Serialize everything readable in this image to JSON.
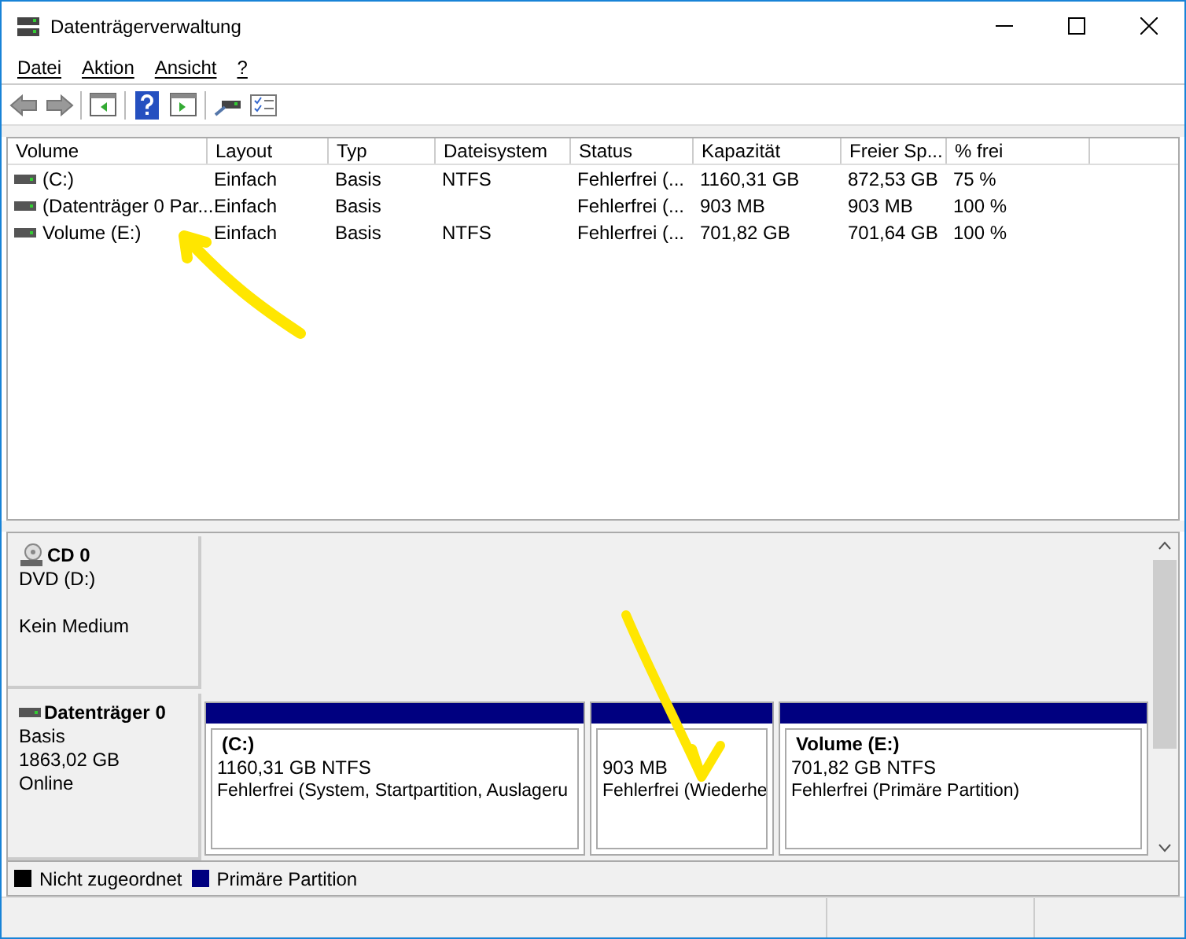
{
  "window": {
    "title": "Datenträgerverwaltung"
  },
  "menu": [
    "Datei",
    "Aktion",
    "Ansicht",
    "?"
  ],
  "table": {
    "columns": [
      "Volume",
      "Layout",
      "Typ",
      "Dateisystem",
      "Status",
      "Kapazität",
      "Freier Sp...",
      "% frei"
    ],
    "rows": [
      [
        "(C:)",
        "Einfach",
        "Basis",
        "NTFS",
        "Fehlerfrei (...",
        "1160,31 GB",
        "872,53 GB",
        "75 %"
      ],
      [
        "(Datenträger 0 Par...",
        "Einfach",
        "Basis",
        "",
        "Fehlerfrei (...",
        "903 MB",
        "903 MB",
        "100 %"
      ],
      [
        "Volume (E:)",
        "Einfach",
        "Basis",
        "NTFS",
        "Fehlerfrei (...",
        "701,82 GB",
        "701,64 GB",
        "100 %"
      ]
    ]
  },
  "disks": [
    {
      "kind": "cd",
      "name": "CD 0",
      "lines": [
        "DVD (D:)",
        "Kein Medium"
      ]
    },
    {
      "kind": "disk",
      "name": "Datenträger 0",
      "lines": [
        "Basis",
        "1863,02 GB",
        "Online"
      ],
      "partitions": [
        {
          "name": "(C:)",
          "size": "1160,31 GB NTFS",
          "status": "Fehlerfrei (System, Startpartition, Auslageru",
          "color": "#000080"
        },
        {
          "size": "903 MB",
          "status": "Fehlerfrei (Wiederhe",
          "color": "#000080"
        },
        {
          "name": "Volume  (E:)",
          "size": "701,82 GB NTFS",
          "status": "Fehlerfrei (Primäre Partition)",
          "color": "#000080"
        }
      ]
    }
  ],
  "legend": [
    {
      "label": "Nicht zugeordnet",
      "color": "#000000"
    },
    {
      "label": "Primäre Partition",
      "color": "#000080"
    }
  ]
}
